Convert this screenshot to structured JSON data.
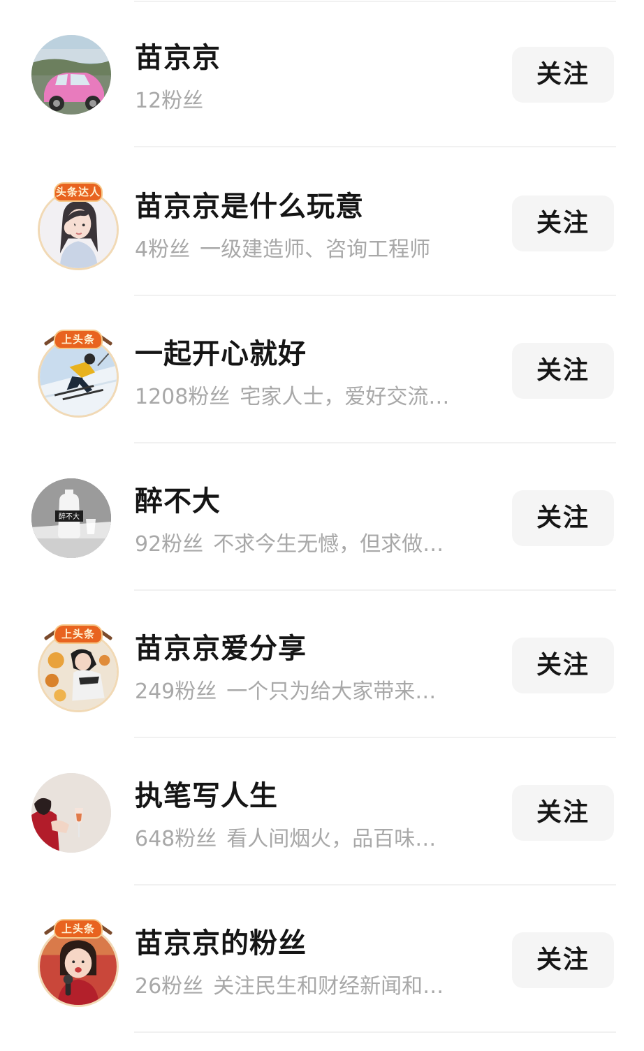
{
  "users": [
    {
      "name": "苗京京",
      "fans": "12粉丝",
      "bio": "",
      "follow_label": "关注",
      "avatar": "pink-car-avatar",
      "badge": ""
    },
    {
      "name": "苗京京是什么玩意",
      "fans": "4粉丝",
      "bio": "一级建造师、咨询工程师",
      "follow_label": "关注",
      "avatar": "girl-portrait-avatar",
      "badge": "头条达人"
    },
    {
      "name": "一起开心就好",
      "fans": "1208粉丝",
      "bio": "宅家人士，爱好交流…",
      "follow_label": "关注",
      "avatar": "skier-avatar",
      "badge": "上头条"
    },
    {
      "name": "醉不大",
      "fans": "92粉丝",
      "bio": "不求今生无憾，但求做…",
      "follow_label": "关注",
      "avatar": "wine-bottle-avatar",
      "badge": ""
    },
    {
      "name": "苗京京爱分享",
      "fans": "249粉丝",
      "bio": "一个只为给大家带来…",
      "follow_label": "关注",
      "avatar": "woman-flowers-avatar",
      "badge": "上头条"
    },
    {
      "name": "执笔写人生",
      "fans": "648粉丝",
      "bio": "看人间烟火，品百味…",
      "follow_label": "关注",
      "avatar": "red-dress-wine-avatar",
      "badge": ""
    },
    {
      "name": "苗京京的粉丝",
      "fans": "26粉丝",
      "bio": "关注民生和财经新闻和…",
      "follow_label": "关注",
      "avatar": "girl-microphone-avatar",
      "badge": "上头条"
    }
  ],
  "avatar_texts": {
    "wine_bottle_label": "醉不大"
  }
}
